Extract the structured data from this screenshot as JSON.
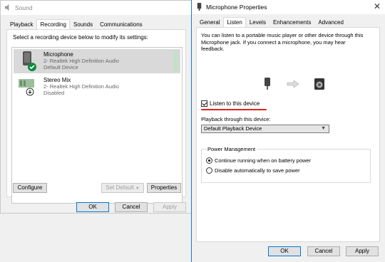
{
  "sound": {
    "title": "Sound",
    "tabs": [
      "Playback",
      "Recording",
      "Sounds",
      "Communications"
    ],
    "active_tab_index": 1,
    "instruction": "Select a recording device below to modify its settings:",
    "devices": [
      {
        "name": "Microphone",
        "driver": "2- Realtek High Definition Audio",
        "status": "Default Device",
        "selected": true
      },
      {
        "name": "Stereo Mix",
        "driver": "2- Realtek High Definition Audio",
        "status": "Disabled",
        "selected": false
      }
    ],
    "buttons": {
      "configure": "Configure",
      "set_default": "Set Default",
      "properties": "Properties",
      "ok": "OK",
      "cancel": "Cancel",
      "apply": "Apply"
    }
  },
  "mic": {
    "title": "Microphone Properties",
    "tabs": [
      "General",
      "Listen",
      "Levels",
      "Enhancements",
      "Advanced"
    ],
    "active_tab_index": 1,
    "description": "You can listen to a portable music player or other device through this Microphone jack.  If you connect a microphone, you may hear feedback.",
    "listen_checkbox": {
      "label": "Listen to this device",
      "checked": true
    },
    "playback_label": "Playback through this device:",
    "playback_selected": "Default Playback Device",
    "power_management": {
      "legend": "Power Management",
      "options": [
        {
          "label": "Continue running when on battery power",
          "selected": true
        },
        {
          "label": "Disable automatically to save power",
          "selected": false
        }
      ]
    },
    "buttons": {
      "ok": "OK",
      "cancel": "Cancel",
      "apply": "Apply"
    }
  },
  "colors": {
    "accent": "#0078d7",
    "selection": "#d9d9d9",
    "annotation_red": "#e02020",
    "default_check": "#10893e"
  },
  "icons": [
    "speaker-icon",
    "close-icon",
    "microphone-icon",
    "check-badge-icon",
    "stereo-mix-icon",
    "arrow-icon",
    "speaker-output-icon"
  ]
}
